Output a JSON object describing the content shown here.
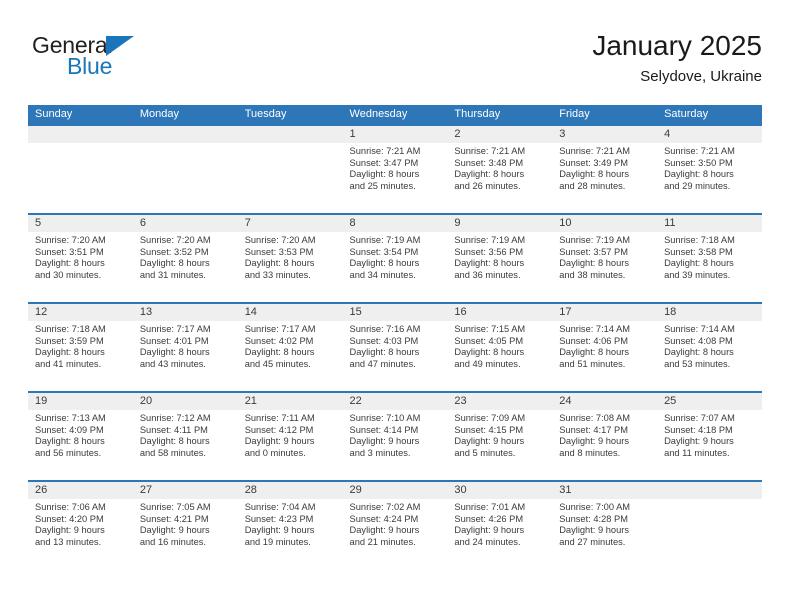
{
  "logo": {
    "word_one": "General",
    "word_two": "Blue",
    "triangle_color": "#1b75bb"
  },
  "header": {
    "title": "January 2025",
    "subtitle": "Selydove, Ukraine"
  },
  "theme": {
    "header_blue": "#2d76b8",
    "date_band": "#efefef",
    "text": "#3b3b3b"
  },
  "calendar": {
    "weekday_headers": [
      "Sunday",
      "Monday",
      "Tuesday",
      "Wednesday",
      "Thursday",
      "Friday",
      "Saturday"
    ],
    "weeks": [
      [
        {
          "day": "",
          "lines": []
        },
        {
          "day": "",
          "lines": []
        },
        {
          "day": "",
          "lines": []
        },
        {
          "day": "1",
          "lines": [
            "Sunrise: 7:21 AM",
            "Sunset: 3:47 PM",
            "Daylight: 8 hours",
            "and 25 minutes."
          ]
        },
        {
          "day": "2",
          "lines": [
            "Sunrise: 7:21 AM",
            "Sunset: 3:48 PM",
            "Daylight: 8 hours",
            "and 26 minutes."
          ]
        },
        {
          "day": "3",
          "lines": [
            "Sunrise: 7:21 AM",
            "Sunset: 3:49 PM",
            "Daylight: 8 hours",
            "and 28 minutes."
          ]
        },
        {
          "day": "4",
          "lines": [
            "Sunrise: 7:21 AM",
            "Sunset: 3:50 PM",
            "Daylight: 8 hours",
            "and 29 minutes."
          ]
        }
      ],
      [
        {
          "day": "5",
          "lines": [
            "Sunrise: 7:20 AM",
            "Sunset: 3:51 PM",
            "Daylight: 8 hours",
            "and 30 minutes."
          ]
        },
        {
          "day": "6",
          "lines": [
            "Sunrise: 7:20 AM",
            "Sunset: 3:52 PM",
            "Daylight: 8 hours",
            "and 31 minutes."
          ]
        },
        {
          "day": "7",
          "lines": [
            "Sunrise: 7:20 AM",
            "Sunset: 3:53 PM",
            "Daylight: 8 hours",
            "and 33 minutes."
          ]
        },
        {
          "day": "8",
          "lines": [
            "Sunrise: 7:19 AM",
            "Sunset: 3:54 PM",
            "Daylight: 8 hours",
            "and 34 minutes."
          ]
        },
        {
          "day": "9",
          "lines": [
            "Sunrise: 7:19 AM",
            "Sunset: 3:56 PM",
            "Daylight: 8 hours",
            "and 36 minutes."
          ]
        },
        {
          "day": "10",
          "lines": [
            "Sunrise: 7:19 AM",
            "Sunset: 3:57 PM",
            "Daylight: 8 hours",
            "and 38 minutes."
          ]
        },
        {
          "day": "11",
          "lines": [
            "Sunrise: 7:18 AM",
            "Sunset: 3:58 PM",
            "Daylight: 8 hours",
            "and 39 minutes."
          ]
        }
      ],
      [
        {
          "day": "12",
          "lines": [
            "Sunrise: 7:18 AM",
            "Sunset: 3:59 PM",
            "Daylight: 8 hours",
            "and 41 minutes."
          ]
        },
        {
          "day": "13",
          "lines": [
            "Sunrise: 7:17 AM",
            "Sunset: 4:01 PM",
            "Daylight: 8 hours",
            "and 43 minutes."
          ]
        },
        {
          "day": "14",
          "lines": [
            "Sunrise: 7:17 AM",
            "Sunset: 4:02 PM",
            "Daylight: 8 hours",
            "and 45 minutes."
          ]
        },
        {
          "day": "15",
          "lines": [
            "Sunrise: 7:16 AM",
            "Sunset: 4:03 PM",
            "Daylight: 8 hours",
            "and 47 minutes."
          ]
        },
        {
          "day": "16",
          "lines": [
            "Sunrise: 7:15 AM",
            "Sunset: 4:05 PM",
            "Daylight: 8 hours",
            "and 49 minutes."
          ]
        },
        {
          "day": "17",
          "lines": [
            "Sunrise: 7:14 AM",
            "Sunset: 4:06 PM",
            "Daylight: 8 hours",
            "and 51 minutes."
          ]
        },
        {
          "day": "18",
          "lines": [
            "Sunrise: 7:14 AM",
            "Sunset: 4:08 PM",
            "Daylight: 8 hours",
            "and 53 minutes."
          ]
        }
      ],
      [
        {
          "day": "19",
          "lines": [
            "Sunrise: 7:13 AM",
            "Sunset: 4:09 PM",
            "Daylight: 8 hours",
            "and 56 minutes."
          ]
        },
        {
          "day": "20",
          "lines": [
            "Sunrise: 7:12 AM",
            "Sunset: 4:11 PM",
            "Daylight: 8 hours",
            "and 58 minutes."
          ]
        },
        {
          "day": "21",
          "lines": [
            "Sunrise: 7:11 AM",
            "Sunset: 4:12 PM",
            "Daylight: 9 hours",
            "and 0 minutes."
          ]
        },
        {
          "day": "22",
          "lines": [
            "Sunrise: 7:10 AM",
            "Sunset: 4:14 PM",
            "Daylight: 9 hours",
            "and 3 minutes."
          ]
        },
        {
          "day": "23",
          "lines": [
            "Sunrise: 7:09 AM",
            "Sunset: 4:15 PM",
            "Daylight: 9 hours",
            "and 5 minutes."
          ]
        },
        {
          "day": "24",
          "lines": [
            "Sunrise: 7:08 AM",
            "Sunset: 4:17 PM",
            "Daylight: 9 hours",
            "and 8 minutes."
          ]
        },
        {
          "day": "25",
          "lines": [
            "Sunrise: 7:07 AM",
            "Sunset: 4:18 PM",
            "Daylight: 9 hours",
            "and 11 minutes."
          ]
        }
      ],
      [
        {
          "day": "26",
          "lines": [
            "Sunrise: 7:06 AM",
            "Sunset: 4:20 PM",
            "Daylight: 9 hours",
            "and 13 minutes."
          ]
        },
        {
          "day": "27",
          "lines": [
            "Sunrise: 7:05 AM",
            "Sunset: 4:21 PM",
            "Daylight: 9 hours",
            "and 16 minutes."
          ]
        },
        {
          "day": "28",
          "lines": [
            "Sunrise: 7:04 AM",
            "Sunset: 4:23 PM",
            "Daylight: 9 hours",
            "and 19 minutes."
          ]
        },
        {
          "day": "29",
          "lines": [
            "Sunrise: 7:02 AM",
            "Sunset: 4:24 PM",
            "Daylight: 9 hours",
            "and 21 minutes."
          ]
        },
        {
          "day": "30",
          "lines": [
            "Sunrise: 7:01 AM",
            "Sunset: 4:26 PM",
            "Daylight: 9 hours",
            "and 24 minutes."
          ]
        },
        {
          "day": "31",
          "lines": [
            "Sunrise: 7:00 AM",
            "Sunset: 4:28 PM",
            "Daylight: 9 hours",
            "and 27 minutes."
          ]
        },
        {
          "day": "",
          "lines": []
        }
      ]
    ]
  }
}
